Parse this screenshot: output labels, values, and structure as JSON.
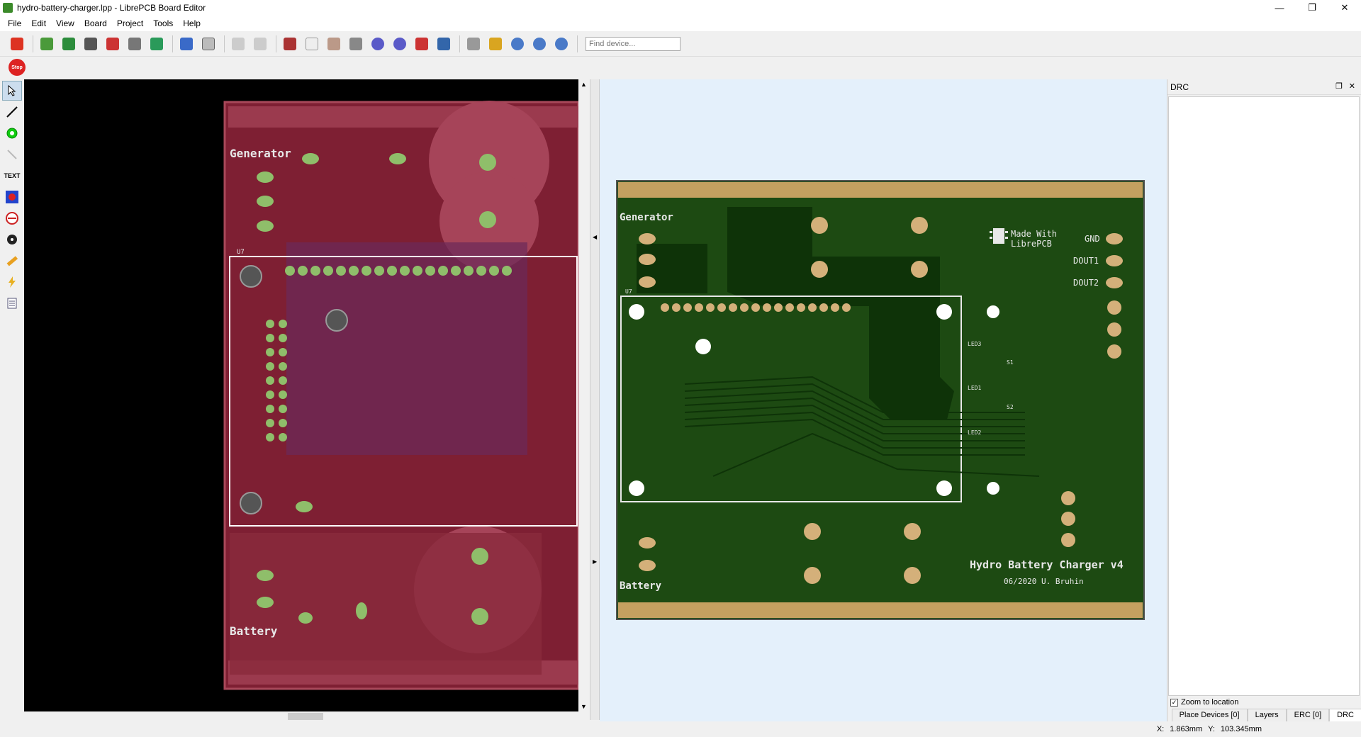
{
  "window": {
    "title": "hydro-battery-charger.lpp - LibrePCB Board Editor",
    "controls": [
      "—",
      "❐",
      "✕"
    ]
  },
  "menu": [
    "File",
    "Edit",
    "View",
    "Board",
    "Project",
    "Tools",
    "Help"
  ],
  "toolbar": {
    "find_placeholder": "Find device...",
    "icons": [
      "close-project",
      "new-board",
      "save",
      "print",
      "export-pdf",
      "order",
      "bom",
      "home",
      "schematic",
      "undo",
      "redo",
      "cut",
      "copy",
      "paste",
      "delete",
      "rotate-ccw",
      "rotate-cw",
      "flip",
      "mirror",
      "grid",
      "lock",
      "zoom-in",
      "zoom-out",
      "zoom-fit"
    ]
  },
  "toolbar2": {
    "stop_label": "Stop"
  },
  "left_tools": {
    "text_label": "TEXT"
  },
  "board_left": {
    "labels": {
      "generator": "Generator",
      "battery": "Battery",
      "u7": "U7"
    }
  },
  "board_right": {
    "labels": {
      "generator": "Generator",
      "battery": "Battery",
      "u7": "U7",
      "made_with": "Made With",
      "librepcb": "LibrePCB",
      "gnd": "GND",
      "dout1": "DOUT1",
      "dout2": "DOUT2",
      "led3": "LED3",
      "led1": "LED1",
      "led2": "LED2",
      "s1": "S1",
      "s2": "S2",
      "title": "Hydro Battery Charger v4",
      "subtitle": "06/2020 U. Bruhin"
    }
  },
  "dock": {
    "title": "DRC",
    "zoom_to_location": "Zoom to location",
    "tabs": [
      "Place Devices [0]",
      "Layers",
      "ERC [0]",
      "DRC"
    ]
  },
  "status": {
    "x_label": "X:",
    "x_value": "1.863mm",
    "y_label": "Y:",
    "y_value": "103.345mm"
  }
}
